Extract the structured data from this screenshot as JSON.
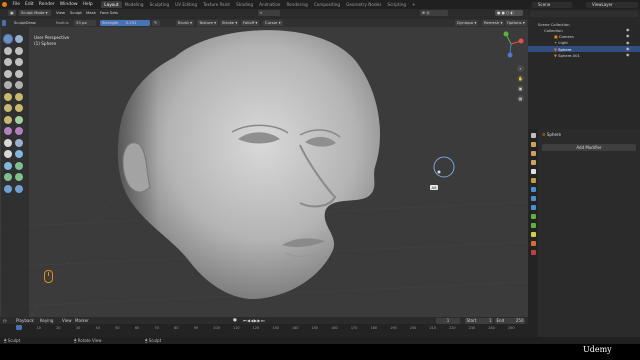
{
  "menubar": {
    "menus": [
      "File",
      "Edit",
      "Render",
      "Window",
      "Help"
    ],
    "workspaces": [
      "Layout",
      "Modeling",
      "Sculpting",
      "UV Editing",
      "Texture Paint",
      "Shading",
      "Animation",
      "Rendering",
      "Compositing",
      "Geometry Nodes",
      "Scripting"
    ],
    "active_workspace": "Layout",
    "scene": "Scene",
    "view_layer": "ViewLayer"
  },
  "header": {
    "mode": "Sculpt Mode",
    "menus": [
      "View",
      "Sculpt",
      "Mask",
      "Face Sets"
    ]
  },
  "tool_settings": {
    "tool": "SculptDraw",
    "radius_label": "Radius",
    "radius_value": "33 px",
    "strength_label": "Strength",
    "strength_value": "0.251",
    "brush": "Brush",
    "texture": "Texture",
    "stroke": "Stroke",
    "falloff": "Falloff",
    "cursor": "Cursor",
    "dyntopo": "Dyntopo",
    "remesh": "Remesh",
    "options": "Options"
  },
  "viewport": {
    "perspective": "User Perspective",
    "object": "(1) Sphere",
    "tooltip": "Alt"
  },
  "outliner": {
    "rows": [
      "Scene Collection",
      "Collection",
      "Camera",
      "Light",
      "Sphere",
      "Sphere.001"
    ],
    "selected": "Sphere"
  },
  "properties": {
    "object_name": "Sphere",
    "add_modifier": "Add Modifier"
  },
  "timeline": {
    "menus": [
      "Playback",
      "Keying",
      "View",
      "Marker"
    ],
    "current_frame": "1",
    "start_label": "Start",
    "start": "1",
    "end_label": "End",
    "end": "250",
    "ticks": [
      "0",
      "10",
      "20",
      "30",
      "40",
      "50",
      "60",
      "70",
      "80",
      "90",
      "100",
      "110",
      "120",
      "130",
      "140",
      "150",
      "160",
      "170",
      "180",
      "190",
      "200",
      "210",
      "220",
      "230",
      "240",
      "250"
    ]
  },
  "statusbar": {
    "items": [
      "Sculpt",
      "Rotate View",
      "Sculpt"
    ],
    "watermark": "Udemy"
  },
  "colors": {
    "accent": "#4772b3",
    "blender_orange": "#e87d0d",
    "viewport_bg": "#3b3b3b",
    "panel_bg": "#2b2b2b",
    "brush_circle": "#7fa3d9"
  }
}
